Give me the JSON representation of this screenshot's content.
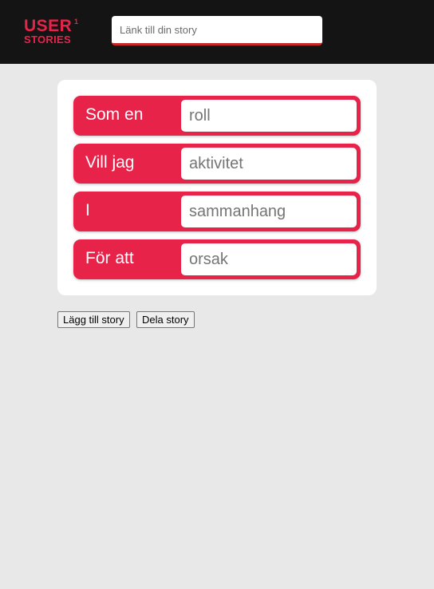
{
  "logo": {
    "line1": "USER",
    "superscript": "1",
    "line2": "STORIES",
    "color": "#e8234a"
  },
  "link_input": {
    "placeholder": "Länk till din story",
    "value": ""
  },
  "story_rows": [
    {
      "label": "Som en",
      "placeholder": "roll"
    },
    {
      "label": "Vill jag",
      "placeholder": "aktivitet"
    },
    {
      "label": "I",
      "placeholder": "sammanhang"
    },
    {
      "label": "För att",
      "placeholder": "orsak"
    }
  ],
  "buttons": {
    "add_story": "Lägg till story",
    "share_story": "Dela story"
  },
  "colors": {
    "accent": "#e8234a",
    "header_bg": "#141414",
    "page_bg": "#e8e8e8"
  }
}
